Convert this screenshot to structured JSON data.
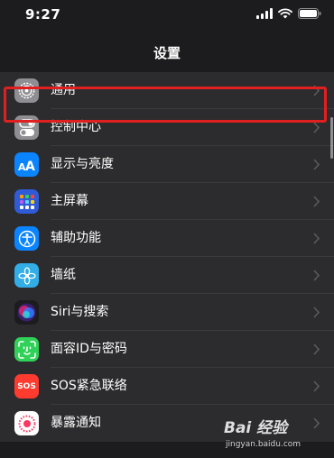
{
  "status_bar": {
    "time": "9:27"
  },
  "nav": {
    "title": "设置"
  },
  "settings": [
    {
      "label": "通用",
      "icon": "gear-icon",
      "color": "#8e8e93"
    },
    {
      "label": "控制中心",
      "icon": "toggles-icon",
      "color": "#8e8e93"
    },
    {
      "label": "显示与亮度",
      "icon": "text-size-icon",
      "color": "#0a84ff"
    },
    {
      "label": "主屏幕",
      "icon": "home-grid-icon",
      "color": "#2f5bd6"
    },
    {
      "label": "辅助功能",
      "icon": "accessibility-icon",
      "color": "#0a84ff"
    },
    {
      "label": "墙纸",
      "icon": "flower-icon",
      "color": "#32ade6"
    },
    {
      "label": "Siri与搜索",
      "icon": "siri-icon",
      "color": "#1c1c1e"
    },
    {
      "label": "面容ID与密码",
      "icon": "face-id-icon",
      "color": "#30d158"
    },
    {
      "label": "SOS紧急联络",
      "icon": "sos-icon",
      "color": "#ff3b30",
      "icon_text": "SOS"
    },
    {
      "label": "暴露通知",
      "icon": "exposure-icon",
      "color": "#ffffff"
    }
  ],
  "watermark": {
    "main": "Bai 经验",
    "sub": "jingyan.baidu.com"
  }
}
